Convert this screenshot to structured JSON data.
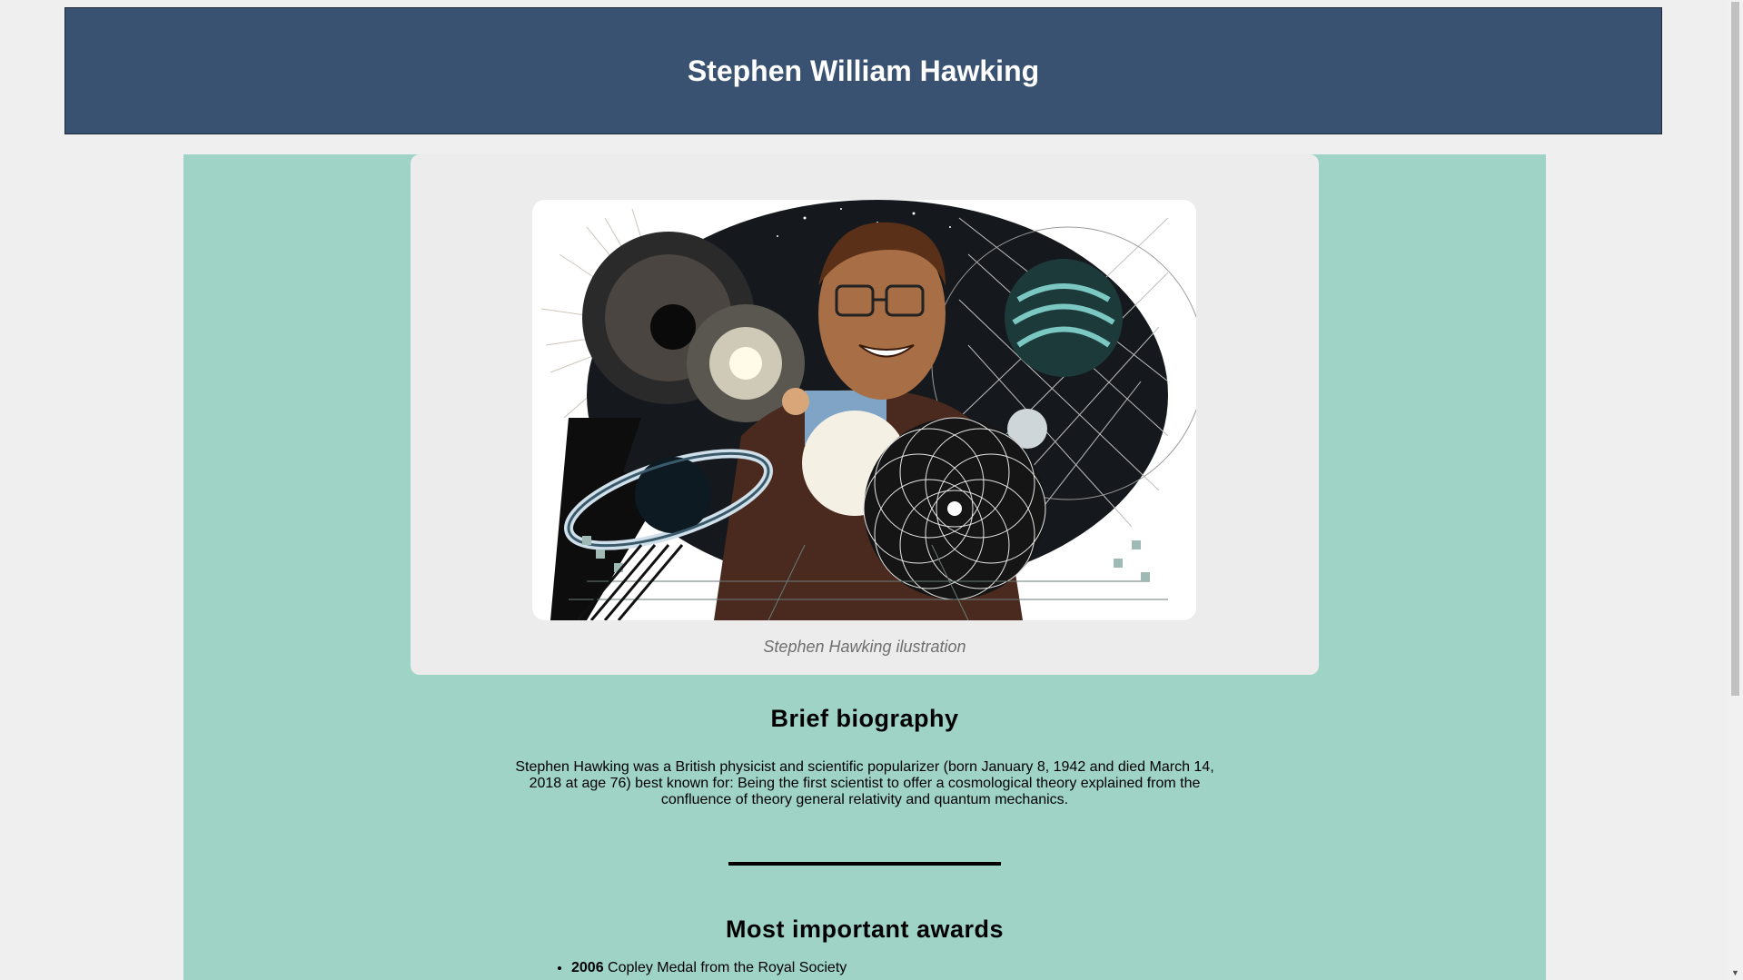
{
  "header": {
    "title": "Stephen William Hawking"
  },
  "figure": {
    "image_alt": "Stephen Hawking ilustration",
    "caption": "Stephen Hawking ilustration"
  },
  "biography": {
    "heading": "Brief biography",
    "text": "Stephen Hawking was a British physicist and scientific popularizer (born January 8, 1942 and died March 14, 2018 at age 76) best known for: Being the first scientist to offer a cosmological theory explained from the confluence of theory general relativity and quantum mechanics."
  },
  "awards": {
    "heading": "Most important awards",
    "items": [
      {
        "year": "2006",
        "text": " Copley Medal from the Royal Society"
      }
    ]
  },
  "colors": {
    "header_bg": "#3a5271",
    "main_bg": "#9ed3c6",
    "card_bg": "#ececec",
    "page_bg": "#efefef"
  },
  "icons": {
    "scroll_down": "scroll-down-arrow-icon"
  }
}
